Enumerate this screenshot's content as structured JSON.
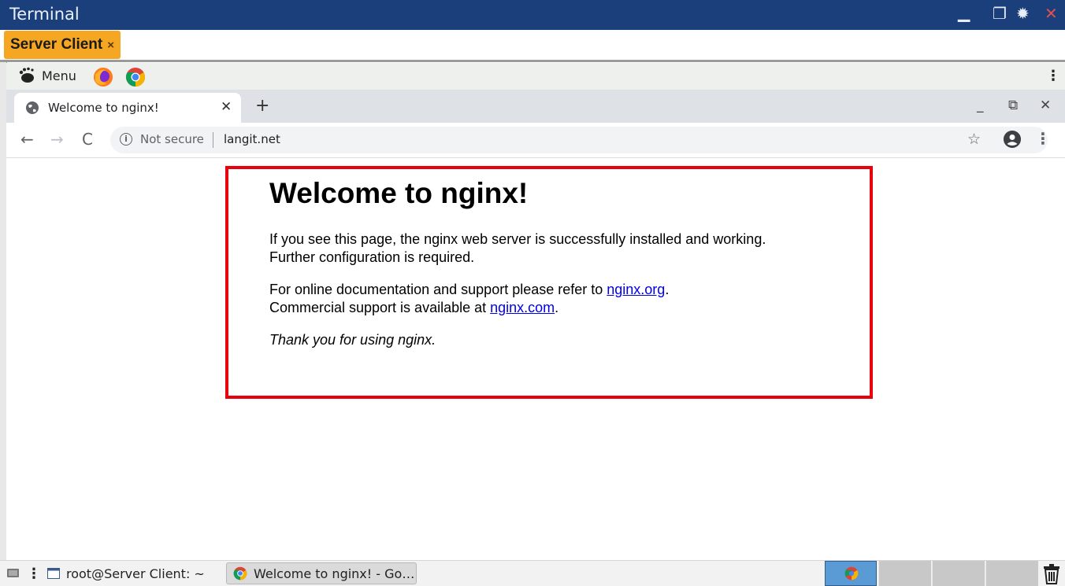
{
  "outer_window": {
    "title": "Terminal",
    "controls": {
      "minimize": "▁",
      "maximize": "❐",
      "settings": "✹",
      "close": "✕"
    }
  },
  "session": {
    "tab_label": "Server Client",
    "tab_close": "×"
  },
  "desktop_panel": {
    "menu_label": "Menu",
    "launchers": [
      "firefox-icon",
      "chrome-icon"
    ]
  },
  "browser": {
    "tab_title": "Welcome to nginx!",
    "tab_close": "✕",
    "new_tab": "+",
    "window_controls": {
      "minimize": "_",
      "restore": "⧉",
      "close": "✕"
    },
    "nav": {
      "back": "←",
      "forward": "→",
      "reload": "C"
    },
    "omnibox": {
      "security": "Not secure",
      "url": "langit.net"
    },
    "star": "☆",
    "kebab": "⋮"
  },
  "page": {
    "heading": "Welcome to nginx!",
    "para1_line1": "If you see this page, the nginx web server is successfully installed and working.",
    "para1_line2": "Further configuration is required.",
    "para2_prefix": "For online documentation and support please refer to ",
    "link_org": "nginx.org",
    "para2_mid": ".",
    "para2_line2_prefix": "Commercial support is available at ",
    "link_com": "nginx.com",
    "para2_end": ".",
    "thanks": "Thank you for using nginx.",
    "highlight_color": "#e8000c"
  },
  "taskbar": {
    "terminal_task": "root@Server Client: ~",
    "chrome_task": "Welcome to nginx! - Go…",
    "workspace_active_color": "#5b9bd5"
  }
}
